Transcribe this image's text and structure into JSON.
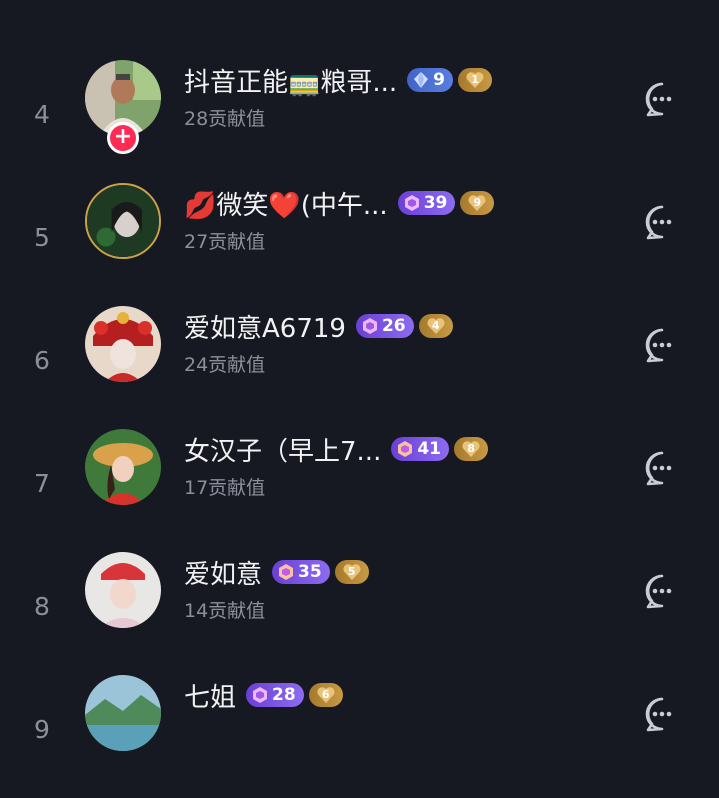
{
  "rows": [
    {
      "rank": "4",
      "name": "抖音正能🚃粮哥...",
      "contribution": "28贡献值",
      "level_type": "diamond",
      "level_icon": "diamond-icon",
      "level": "9",
      "fan_level": "1",
      "avatar": "avatar-man-outdoors",
      "has_follow_button": true,
      "framed": false
    },
    {
      "rank": "5",
      "name": "💋微笑❤️(中午...",
      "contribution": "27贡献值",
      "level_type": "gem",
      "level_icon": "gem-icon",
      "level": "39",
      "fan_level": "9",
      "avatar": "avatar-woman-green",
      "has_follow_button": false,
      "framed": true
    },
    {
      "rank": "6",
      "name": "爱如意A6719",
      "contribution": "24贡献值",
      "level_type": "gem",
      "level_icon": "gem-icon",
      "level": "26",
      "fan_level": "4",
      "avatar": "avatar-woman-headdress",
      "has_follow_button": false,
      "framed": false
    },
    {
      "rank": "7",
      "name": "女汉子（早上7...",
      "contribution": "17贡献值",
      "level_type": "gem",
      "level_icon": "gem-icon",
      "level": "41",
      "fan_level": "8",
      "avatar": "avatar-woman-straw-hat",
      "has_follow_button": false,
      "framed": false
    },
    {
      "rank": "8",
      "name": "爱如意",
      "contribution": "14贡献值",
      "level_type": "gem",
      "level_icon": "gem-icon",
      "level": "35",
      "fan_level": "5",
      "avatar": "avatar-woman-red-cap",
      "has_follow_button": false,
      "framed": false
    },
    {
      "rank": "9",
      "name": "七姐",
      "contribution": "",
      "level_type": "gem",
      "level_icon": "gem-icon",
      "level": "28",
      "fan_level": "6",
      "avatar": "avatar-landscape",
      "has_follow_button": false,
      "framed": false
    }
  ],
  "icons": {
    "follow": "plus-icon",
    "message": "chat-bubble-icon"
  },
  "colors": {
    "background": "#161922",
    "follow_button": "#fe2c55",
    "diamond_badge": "#4a6cd4",
    "gem_badge": "#7b55e6",
    "fan_badge": "#b8893a"
  }
}
